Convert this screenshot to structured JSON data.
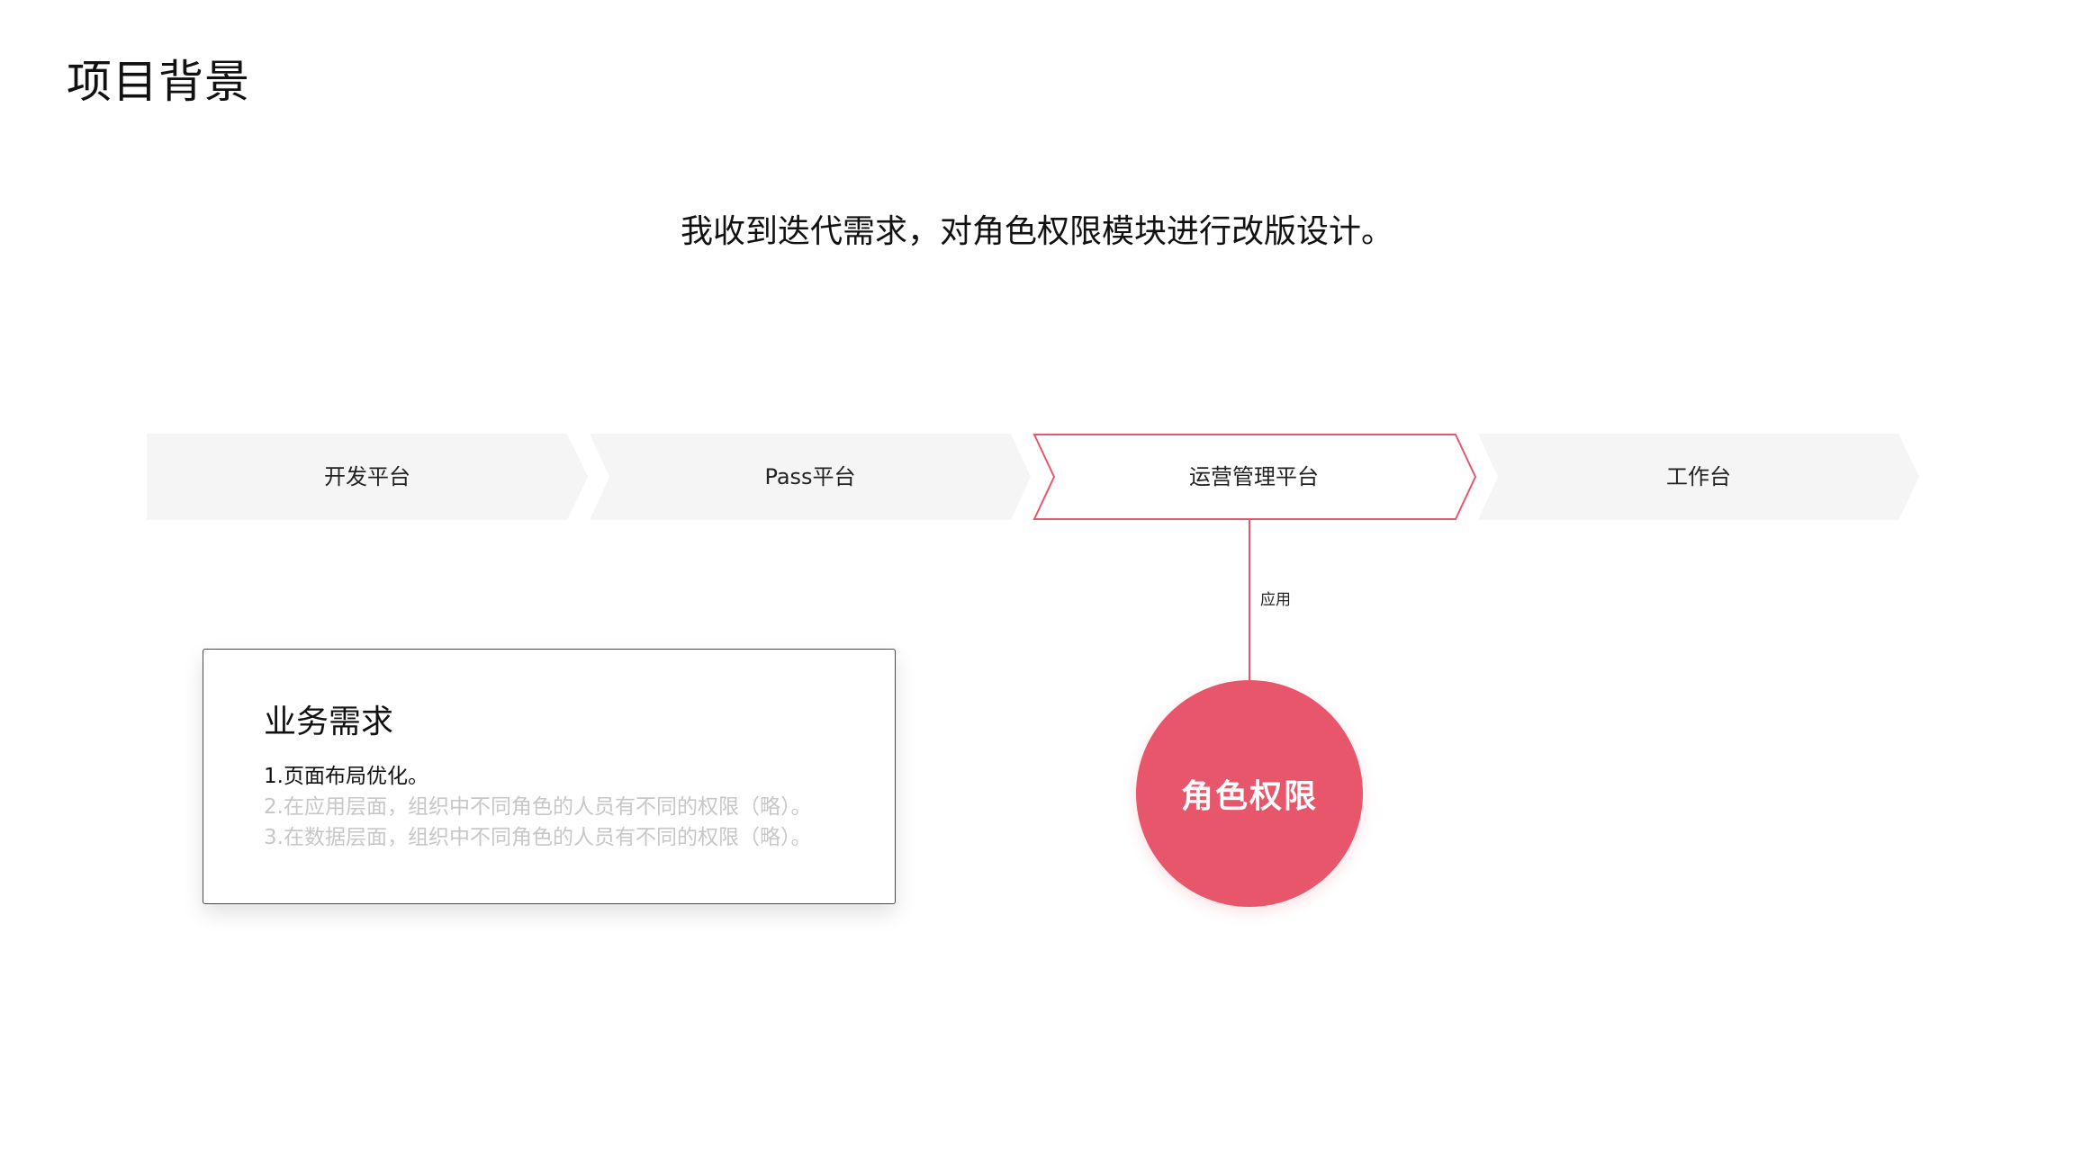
{
  "page": {
    "title": "项目背景",
    "subtitle": "我收到迭代需求，对角色权限模块进行改版设计。"
  },
  "flow": {
    "steps": [
      {
        "label": "开发平台",
        "highlighted": false
      },
      {
        "label": "Pass平台",
        "highlighted": false
      },
      {
        "label": "运营管理平台",
        "highlighted": true
      },
      {
        "label": "工作台",
        "highlighted": false
      }
    ],
    "connector_label": "应用",
    "target_label": "角色权限"
  },
  "requirements": {
    "title": "业务需求",
    "items": [
      {
        "text": "1.页面布局优化。",
        "active": true
      },
      {
        "text": "2.在应用层面，组织中不同角色的人员有不同的权限（略）。",
        "active": false
      },
      {
        "text": "3.在数据层面，组织中不同角色的人员有不同的权限（略）。",
        "active": false
      }
    ]
  },
  "colors": {
    "accent": "#e8566c",
    "step_fill": "#f5f5f5",
    "muted_text": "#c7c7c7",
    "text": "#111111"
  }
}
